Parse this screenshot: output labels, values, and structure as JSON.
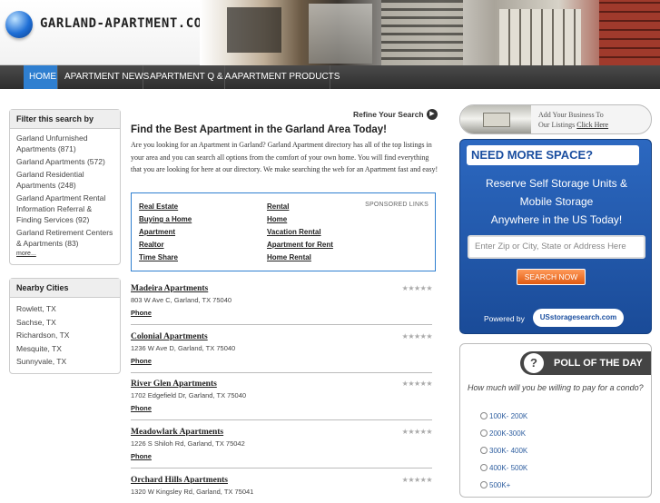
{
  "header": {
    "site_title": "GARLAND-APARTMENT.COM"
  },
  "nav": [
    "HOME",
    "APARTMENT NEWS",
    "APARTMENT Q & A",
    "APARTMENT PRODUCTS"
  ],
  "filter": {
    "title": "Filter this search by",
    "items": [
      "Garland Unfurnished Apartments (871)",
      "Garland Apartments (572)",
      "Garland Residential Apartments (248)",
      "Garland Apartment Rental Information Referral & Finding Services (92)",
      "Garland Retirement Centers & Apartments (83)"
    ],
    "more": "more..."
  },
  "cities": {
    "title": "Nearby Cities",
    "items": [
      "Rowlett, TX",
      "Sachse, TX",
      "Richardson, TX",
      "Mesquite, TX",
      "Sunnyvale, TX"
    ]
  },
  "main": {
    "refine": "Refine Your Search",
    "title": "Find the Best Apartment in the Garland Area Today!",
    "intro": "Are you looking for an Apartment in Garland? Garland Apartment directory has all of the top listings in your area and you can search all options from the comfort of your own home. You will find everything that you are looking for here at our directory. We make searching the web for an Apartment fast and easy!"
  },
  "sponsored": {
    "label": "SPONSORED LINKS",
    "left": [
      "Real Estate",
      "Buying a Home",
      "Apartment",
      "Realtor",
      "Time Share"
    ],
    "right": [
      "Rental",
      "Home",
      "Vacation Rental",
      "Apartment for Rent",
      "Home Rental"
    ]
  },
  "listings": [
    {
      "name": "Madeira Apartments",
      "address": "803 W Ave C, Garland, TX 75040",
      "phone": "Phone",
      "rating": 0
    },
    {
      "name": "Colonial Apartments",
      "address": "1236 W Ave D, Garland, TX 75040",
      "phone": "Phone",
      "rating": 0
    },
    {
      "name": "River Glen Apartments",
      "address": "1702 Edgefield Dr, Garland, TX 75040",
      "phone": "Phone",
      "rating": 0
    },
    {
      "name": "Meadowlark Apartments",
      "address": "1226 S Shiloh Rd, Garland, TX 75042",
      "phone": "Phone",
      "rating": 4
    },
    {
      "name": "Orchard Hills Apartments",
      "address": "1320 W Kingsley Rd, Garland, TX 75041",
      "phone": "",
      "rating": 0
    }
  ],
  "ad_small": {
    "line1": "Add Your Business To",
    "line2": "Our Listings",
    "link": "Click Here"
  },
  "storage": {
    "heading": "NEED MORE SPACE?",
    "body1": "Reserve Self Storage Units &",
    "body2": "Mobile Storage",
    "body3": "Anywhere in the US Today!",
    "placeholder": "Enter Zip or City, State or Address Here",
    "button": "SEARCH NOW",
    "powered": "Powered by",
    "logo": "USstoragesearch.com"
  },
  "poll": {
    "heading": "POLL OF THE DAY",
    "question": "How much will you be willing to pay for a condo?",
    "options": [
      "100K- 200K",
      "200K-300K",
      "300K- 400K",
      "400K- 500K",
      "500K+"
    ]
  }
}
